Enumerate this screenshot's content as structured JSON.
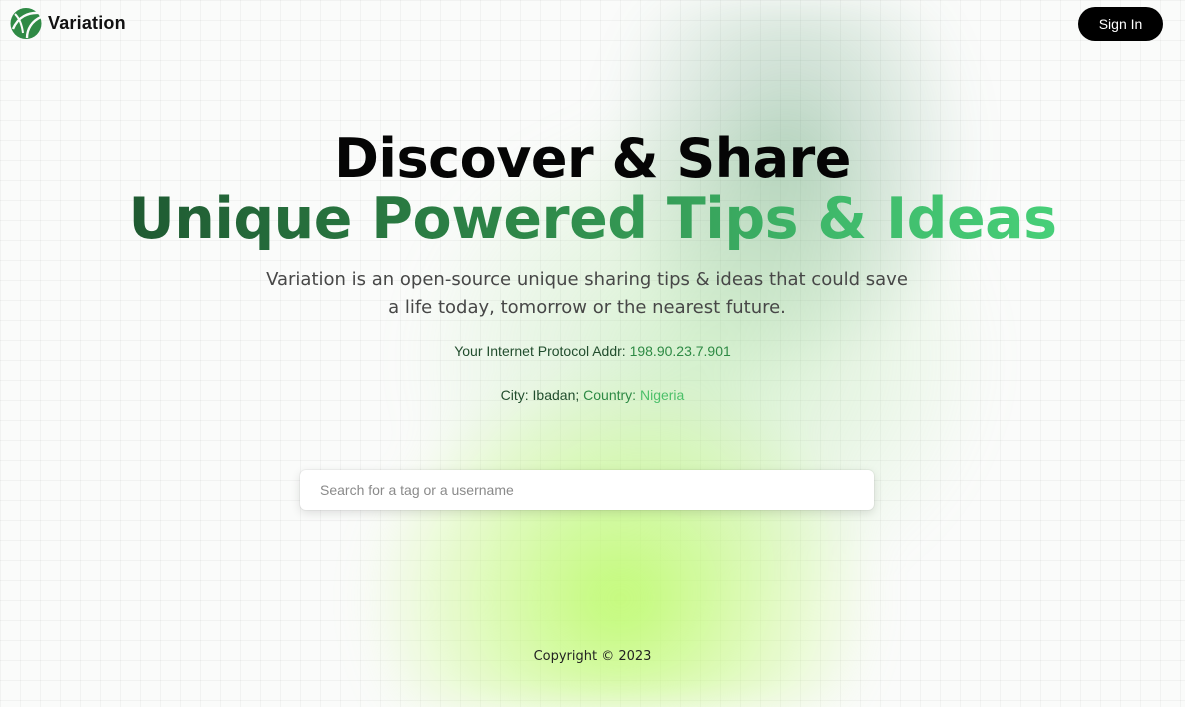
{
  "navbar": {
    "brand_name": "Variation",
    "logo_icon": "leaf-logo-icon",
    "signin_label": "Sign In"
  },
  "hero": {
    "title_line1": "Discover & Share",
    "title_line2": "Unique Powered Tips & Ideas",
    "description": "Variation is an open-source unique sharing tips & ideas that could save a life today, tomorrow or the nearest future."
  },
  "info": {
    "ip_label": "Your Internet Protocol Addr:",
    "ip_value": "198.90.23.7.901",
    "city_label": "City:",
    "city_value": "Ibadan;",
    "country_label": "Country:",
    "country_value": "Nigeria"
  },
  "search": {
    "placeholder": "Search for a tag or a username",
    "value": ""
  },
  "footer": {
    "copyright": "Copyright © 2023"
  },
  "colors": {
    "brand_dark_green": "#1f5a32",
    "brand_light_green": "#47cf78",
    "signin_bg": "#000000",
    "glow_lime": "#bffa6e"
  }
}
